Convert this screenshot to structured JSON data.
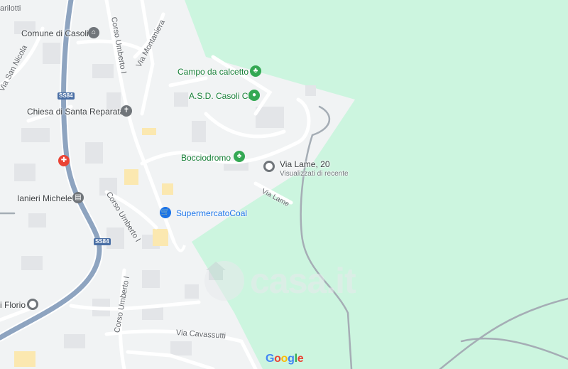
{
  "map": {
    "labels": {
      "comune": "Comune di Casoli",
      "chiesa": "Chiesa di Santa Reparata",
      "ianieri": "Ianieri Michele",
      "florio": "i Florio",
      "campo": "Campo da calcetto",
      "asd": "A.S.D. Casoli C5",
      "bocciodromo": "Bocciodromo",
      "supermercato": "SupermercatoCoal",
      "via_lame_title": "Via Lame, 20",
      "via_lame_sub": "Visualizzati di recente"
    },
    "streets": {
      "corso_umberto_top": "Corso Umberto I",
      "corso_umberto_mid": "Corso Umberto I",
      "corso_umberto_bottom": "Corso Umberto I",
      "via_montaniera": "Via Montaniera",
      "via_san_nicola": "Via San Nicola",
      "via_lame": "Via Lame",
      "via_cavassutti": "Via Cavassutti",
      "arilotti": "arilotti"
    },
    "shields": {
      "ss84_top": "SS84",
      "ss84_bottom": "SS84"
    },
    "watermark": "casa.it",
    "attribution": {
      "g1": "G",
      "o1": "o",
      "o2": "o",
      "g2": "g",
      "l": "l",
      "e": "e"
    },
    "colors": {
      "land_green": "#ccf5df",
      "urban": "#f1f3f4",
      "road": "#ffffff",
      "main_road": "#8ea4c0",
      "poi_green": "#34a853",
      "poi_blue": "#1a73e8"
    },
    "icons": {
      "campo": "park-tree-icon",
      "asd": "sports-icon",
      "bocciodromo": "park-tree-icon",
      "chiesa": "church-icon",
      "comune": "government-icon",
      "ianieri": "shop-icon",
      "supermercato": "shopping-cart-icon",
      "via_lame": "recent-location-icon",
      "hospital": "hospital-icon",
      "florio": "place-icon"
    }
  }
}
